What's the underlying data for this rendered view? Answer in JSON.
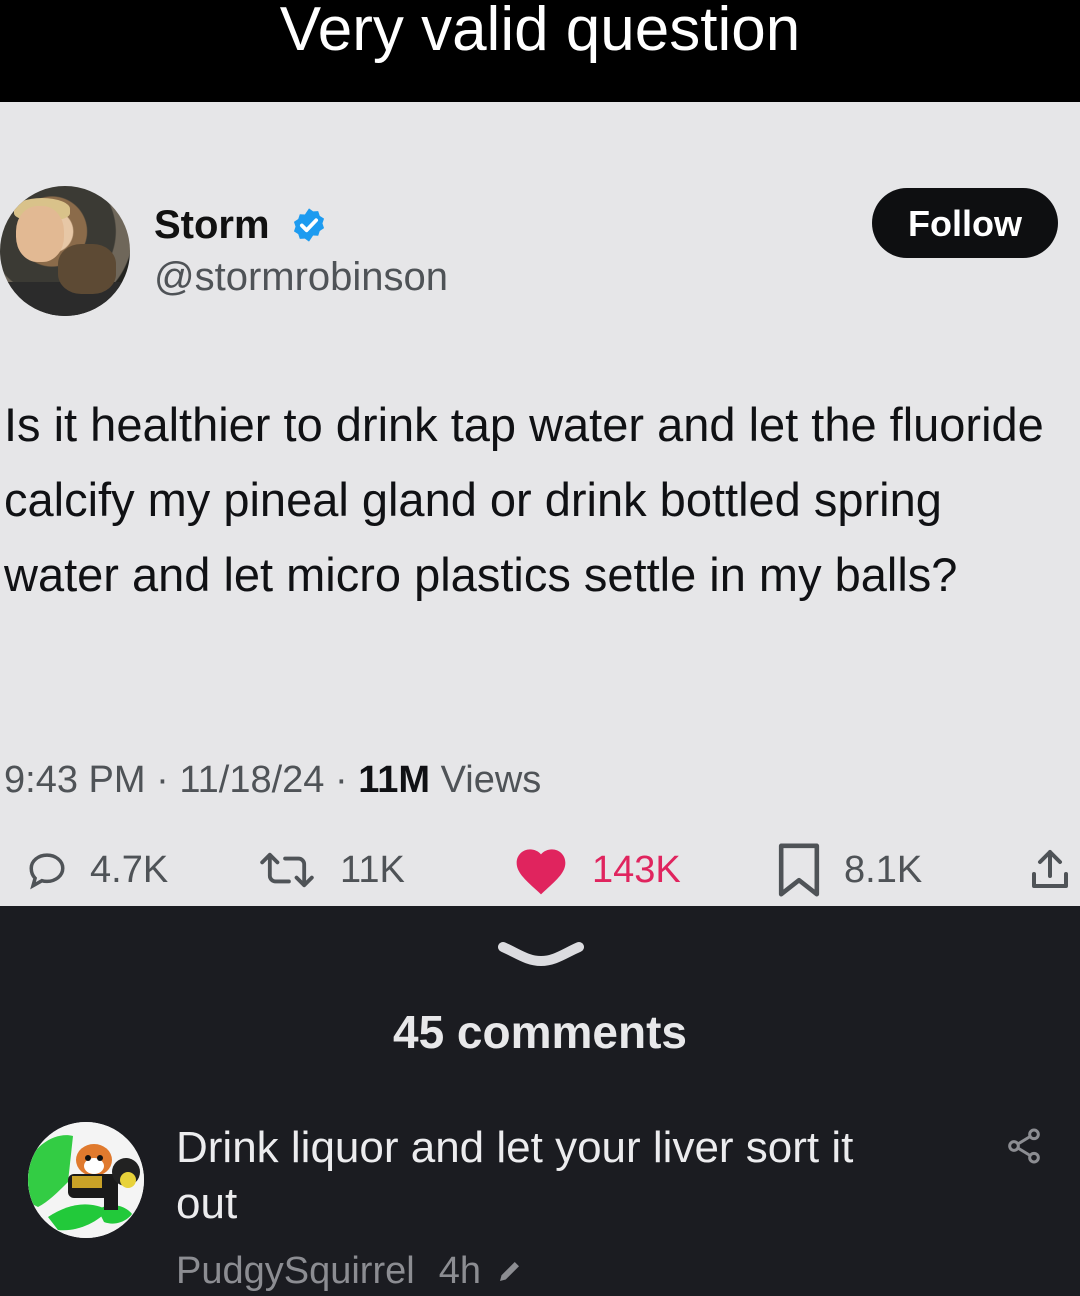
{
  "caption": "Very valid question",
  "tweet": {
    "author_name": "Storm",
    "author_handle": "@stormrobinson",
    "follow_label": "Follow",
    "text": "Is it healthier to drink tap water and let the fluoride calcify my pineal gland or drink bottled spring water and let micro plastics settle in my balls?",
    "time": "9:43 PM",
    "date": "11/18/24",
    "views_count": "11M",
    "views_label": "Views",
    "replies": "4.7K",
    "reposts": "11K",
    "likes": "143K",
    "bookmarks": "8.1K",
    "like_color": "#e0245e",
    "verified_color": "#1d9bf0"
  },
  "comments": {
    "count_label": "45 comments",
    "items": [
      {
        "text": "Drink liquor and let your liver sort it out",
        "author": "PudgySquirrel",
        "age": "4h"
      }
    ]
  }
}
